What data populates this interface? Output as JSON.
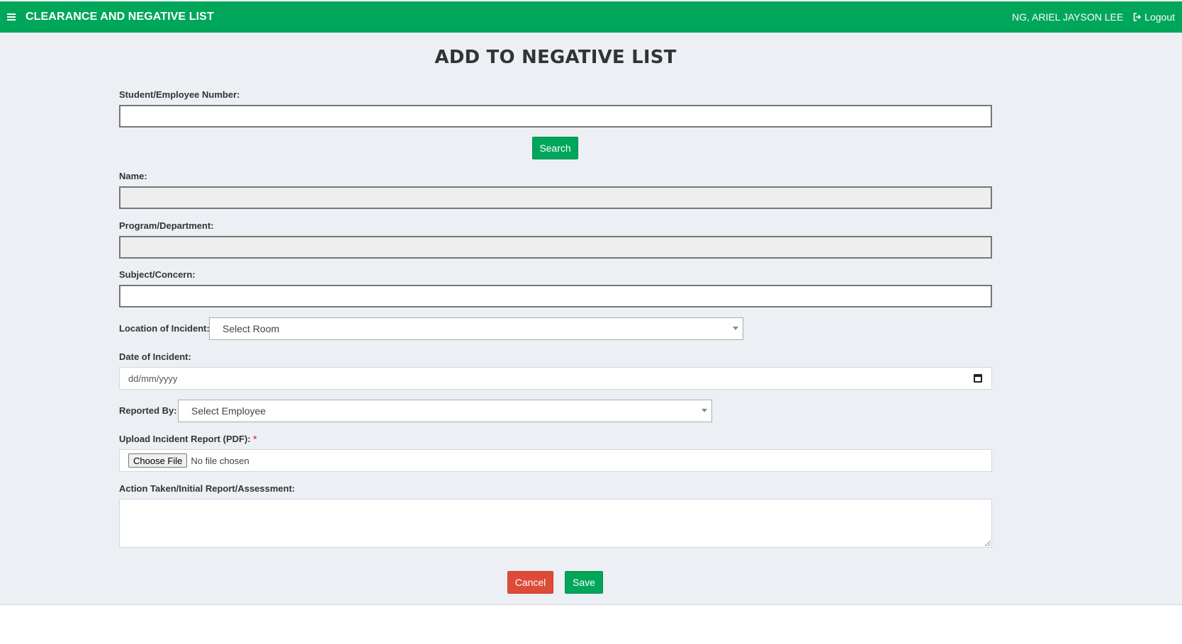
{
  "header": {
    "menu_icon": "hamburger-menu-icon",
    "app_title": "CLEARANCE AND NEGATIVE LIST",
    "user_name": "NG, ARIEL JAYSON LEE",
    "logout_label": "Logout",
    "logout_icon": "sign-out-icon",
    "bar_color": "#00a65a"
  },
  "page": {
    "title": "ADD TO NEGATIVE LIST"
  },
  "form": {
    "id_number": {
      "label": "Student/Employee Number:",
      "value": ""
    },
    "search_button": "Search",
    "name": {
      "label": "Name:",
      "value": ""
    },
    "program": {
      "label": "Program/Department:",
      "value": ""
    },
    "subject": {
      "label": "Subject/Concern:",
      "value": ""
    },
    "location": {
      "label": "Location of Incident:",
      "selected": "Select Room"
    },
    "date": {
      "label": "Date of Incident:",
      "placeholder": "dd/mm/yyyy",
      "icon": "calendar-icon"
    },
    "reported_by": {
      "label": "Reported By:",
      "selected": "Select Employee"
    },
    "upload": {
      "label": "Upload Incident Report (PDF):",
      "required_mark": "*",
      "button": "Choose File",
      "status": "No file chosen"
    },
    "action_taken": {
      "label": "Action Taken/Initial Report/Assessment:",
      "value": ""
    }
  },
  "actions": {
    "cancel": "Cancel",
    "save": "Save",
    "cancel_color": "#dd4b39",
    "save_color": "#00a65a"
  }
}
